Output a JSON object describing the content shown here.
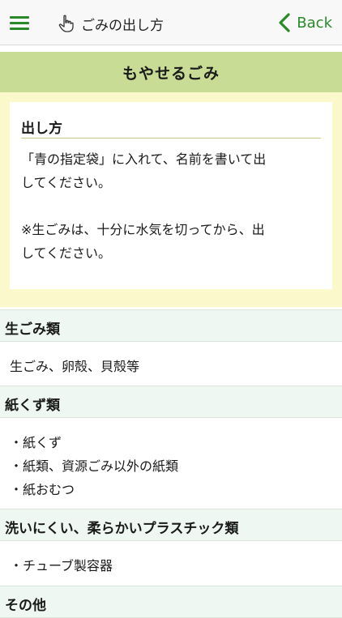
{
  "nav": {
    "title": "ごみの出し方",
    "back_label": "Back",
    "menu_icon": "hamburger-menu-icon",
    "title_icon": "pointing-hand-icon",
    "back_icon": "chevron-left-icon",
    "accent_color": "#2a8a2a"
  },
  "category": {
    "title": "もやせるごみ",
    "color": "#c9dc96"
  },
  "howto": {
    "heading": "出し方",
    "body": "「青の指定袋」に入れて、名前を書いて出\nしてください。\n\n※生ごみは、十分に水気を切ってから、出\nしてください。"
  },
  "sections": [
    {
      "title": "生ごみ類",
      "items": [
        "生ごみ、卵殻、貝殻等"
      ]
    },
    {
      "title": "紙くず類",
      "items": [
        "・紙くず",
        "・紙類、資源ごみ以外の紙類",
        "・紙おむつ"
      ]
    },
    {
      "title": "洗いにくい、柔らかいプラスチック類",
      "items": [
        "・チューブ製容器"
      ]
    },
    {
      "title": "その他"
    }
  ]
}
